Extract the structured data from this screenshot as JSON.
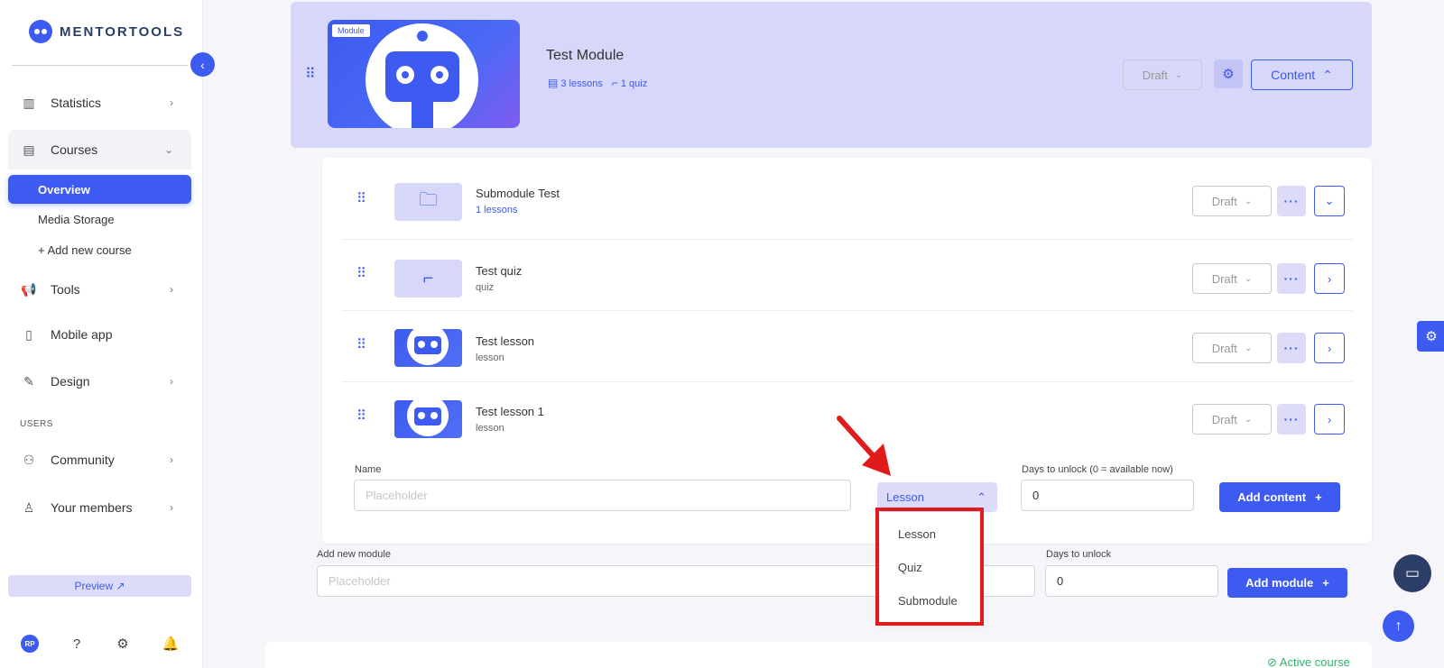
{
  "brand": {
    "name": "MENTORTOOLS"
  },
  "sidebar": {
    "items": [
      {
        "label": "Statistics",
        "icon": "bar-chart-icon"
      },
      {
        "label": "Courses",
        "icon": "book-icon"
      },
      {
        "label": "Tools",
        "icon": "megaphone-icon"
      },
      {
        "label": "Mobile app",
        "icon": "phone-icon"
      },
      {
        "label": "Design",
        "icon": "pencil-icon"
      },
      {
        "label": "Community",
        "icon": "people-icon"
      },
      {
        "label": "Your members",
        "icon": "user-icon"
      }
    ],
    "courses_sub": [
      "Overview",
      "Media Storage",
      "+ Add new course"
    ],
    "section_users": "USERS",
    "preview": "Preview ↗",
    "avatar": "RP"
  },
  "module": {
    "badge": "Module",
    "title": "Test Module",
    "lessons": "3 lessons",
    "quiz": "1 quiz",
    "status": "Draft",
    "content_label": "Content"
  },
  "rows": [
    {
      "title": "Submodule Test",
      "sub": "1 lessons",
      "status": "Draft"
    },
    {
      "title": "Test quiz",
      "sub": "quiz",
      "status": "Draft"
    },
    {
      "title": "Test lesson",
      "sub": "lesson",
      "status": "Draft"
    },
    {
      "title": "Test lesson 1",
      "sub": "lesson",
      "status": "Draft"
    }
  ],
  "add_content": {
    "name_label": "Name",
    "name_placeholder": "Placeholder",
    "type_selected": "Lesson",
    "days_label": "Days to unlock (0 = available now)",
    "days_value": "0",
    "button": "Add content"
  },
  "type_options": [
    "Lesson",
    "Quiz",
    "Submodule"
  ],
  "add_module": {
    "label": "Add new module",
    "placeholder": "Placeholder",
    "days_label": "Days to unlock",
    "days_value": "0",
    "button": "Add module"
  },
  "footer": {
    "active_course": "Active course"
  },
  "colors": {
    "accent": "#3d5af1",
    "highlight": "#e01b1b",
    "active": "#2cb56b"
  }
}
